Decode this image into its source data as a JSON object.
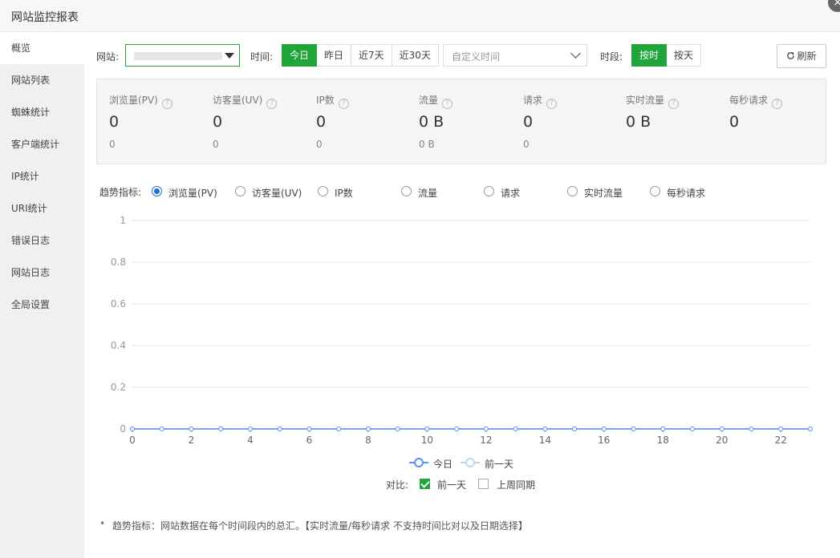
{
  "window": {
    "title": "网站监控报表",
    "close_icon": "×"
  },
  "sidebar": {
    "items": [
      {
        "label": "概览",
        "active": true
      },
      {
        "label": "网站列表"
      },
      {
        "label": "蜘蛛统计"
      },
      {
        "label": "客户端统计"
      },
      {
        "label": "IP统计"
      },
      {
        "label": "URI统计"
      },
      {
        "label": "错误日志"
      },
      {
        "label": "网站日志"
      },
      {
        "label": "全局设置"
      }
    ]
  },
  "toolbar": {
    "site_label": "网站:",
    "time_label": "时间:",
    "time_options": [
      "今日",
      "昨日",
      "近7天",
      "近30天"
    ],
    "custom_time_placeholder": "自定义时间",
    "period_label": "时段:",
    "period_options": [
      "按时",
      "按天"
    ],
    "refresh_label": "刷新"
  },
  "stats": [
    {
      "name": "浏览量(PV)",
      "value": "0",
      "prev": "0"
    },
    {
      "name": "访客量(UV)",
      "value": "0",
      "prev": "0"
    },
    {
      "name": "IP数",
      "value": "0",
      "prev": "0"
    },
    {
      "name": "流量",
      "value": "0 B",
      "prev": "0 B"
    },
    {
      "name": "请求",
      "value": "0",
      "prev": "0"
    },
    {
      "name": "实时流量",
      "value": "0 B",
      "prev": ""
    },
    {
      "name": "每秒请求",
      "value": "0",
      "prev": ""
    }
  ],
  "trend": {
    "label": "趋势指标:",
    "options": [
      "浏览量(PV)",
      "访客量(UV)",
      "IP数",
      "流量",
      "请求",
      "实时流量",
      "每秒请求"
    ],
    "selected": 0
  },
  "chart_data": {
    "type": "line",
    "x": [
      0,
      1,
      2,
      3,
      4,
      5,
      6,
      7,
      8,
      9,
      10,
      11,
      12,
      13,
      14,
      15,
      16,
      17,
      18,
      19,
      20,
      21,
      22,
      23
    ],
    "x_tick_labels": [
      "0",
      "2",
      "4",
      "6",
      "8",
      "10",
      "12",
      "14",
      "16",
      "18",
      "20",
      "22"
    ],
    "y_tick_labels": [
      "0",
      "0.2",
      "0.4",
      "0.6",
      "0.8",
      "1"
    ],
    "ylim": [
      0,
      1
    ],
    "xlim": [
      0,
      23
    ],
    "grid": true,
    "legend_position": "bottom",
    "series": [
      {
        "name": "今日",
        "color": "#5b8ff9",
        "values": [
          0,
          0,
          0,
          0,
          0,
          0,
          0,
          0,
          0,
          0,
          0,
          0,
          0,
          0,
          0,
          0,
          0,
          0,
          0,
          0,
          0,
          0,
          0,
          0
        ]
      },
      {
        "name": "前一天",
        "color": "#b8d8f0",
        "values": [
          0,
          0,
          0,
          0,
          0,
          0,
          0,
          0,
          0,
          0,
          0,
          0,
          0,
          0,
          0,
          0,
          0,
          0,
          0,
          0,
          0,
          0,
          0,
          0
        ]
      }
    ]
  },
  "compare": {
    "label": "对比:",
    "options": [
      {
        "label": "前一天",
        "checked": true
      },
      {
        "label": "上周同期",
        "checked": false
      }
    ]
  },
  "note": "趋势指标：网站数据在每个时间段内的总汇。【实时流量/每秒请求 不支持时间比对以及日期选择】",
  "colors": {
    "accent": "#20a53a",
    "radio": "#1e6fd9"
  }
}
